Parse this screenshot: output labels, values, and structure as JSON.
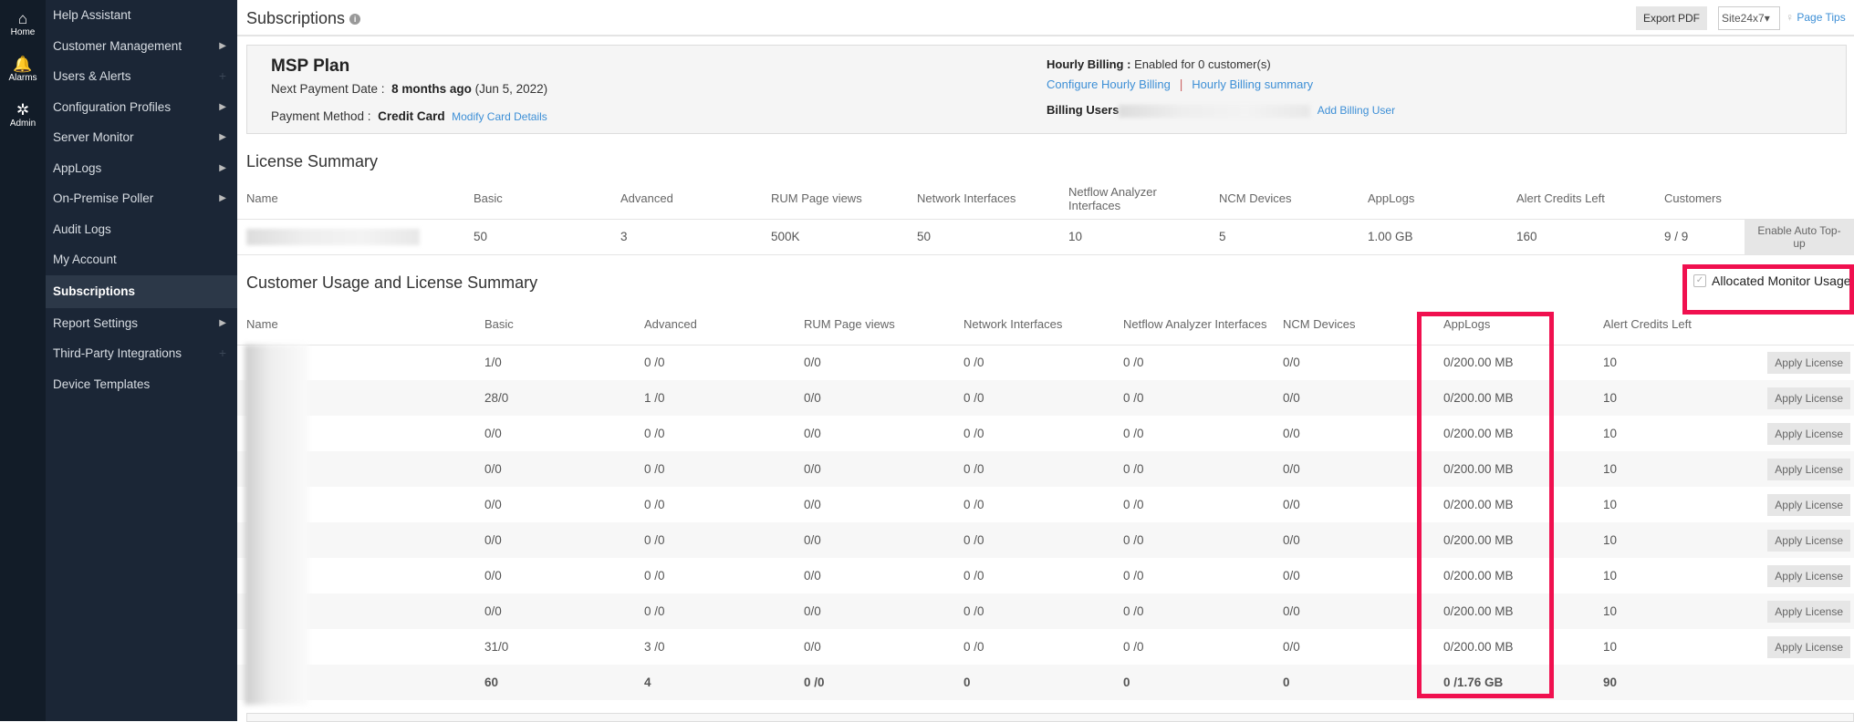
{
  "iconbar": [
    {
      "label": "Home",
      "icon": "home-icon"
    },
    {
      "label": "Alarms",
      "icon": "bell-icon"
    },
    {
      "label": "Admin",
      "icon": "gear-icon"
    }
  ],
  "sidebar": {
    "items": [
      {
        "label": "Help Assistant",
        "mark": ""
      },
      {
        "label": "Customer Management",
        "mark": "arrow"
      },
      {
        "label": "Users & Alerts",
        "mark": "plus"
      },
      {
        "label": "Configuration Profiles",
        "mark": "arrow"
      },
      {
        "label": "Server Monitor",
        "mark": "arrow"
      },
      {
        "label": "AppLogs",
        "mark": "arrow"
      },
      {
        "label": "On-Premise Poller",
        "mark": "arrow"
      },
      {
        "label": "Audit Logs",
        "mark": ""
      },
      {
        "label": "My Account",
        "mark": ""
      },
      {
        "label": "Subscriptions",
        "mark": "",
        "active": true
      },
      {
        "label": "Report Settings",
        "mark": "arrow"
      },
      {
        "label": "Third-Party Integrations",
        "mark": "plus"
      },
      {
        "label": "Device Templates",
        "mark": ""
      }
    ]
  },
  "header": {
    "title": "Subscriptions",
    "export": "Export PDF",
    "site": "Site24x7",
    "page_tips": "Page Tips"
  },
  "plan": {
    "name": "MSP Plan",
    "next_payment_label": "Next Payment Date :",
    "next_payment_rel": "8 months ago",
    "next_payment_date": "(Jun 5, 2022)",
    "payment_method_label": "Payment Method :",
    "payment_method": "Credit Card",
    "modify": "Modify Card Details",
    "hourly_label": "Hourly Billing :",
    "hourly_value": "Enabled for 0 customer(s)",
    "configure": "Configure Hourly Billing",
    "sep": "|",
    "summary": "Hourly Billing summary",
    "billing_users_label": "Billing Users",
    "add_billing_user": "Add Billing User"
  },
  "license": {
    "title": "License Summary",
    "headers": [
      "Name",
      "Basic",
      "Advanced",
      "RUM Page views",
      "Network Interfaces",
      "Netflow Analyzer Interfaces",
      "NCM Devices",
      "AppLogs",
      "Alert Credits Left",
      "Customers"
    ],
    "row": [
      "",
      "50",
      "3",
      "500K",
      "50",
      "10",
      "5",
      "1.00 GB",
      "160",
      "9 / 9"
    ],
    "button": "Enable Auto Top-up"
  },
  "usage": {
    "title": "Customer Usage and License Summary",
    "allocated_label": "Allocated Monitor Usage",
    "allocated_checked": true,
    "highlight_color": "#f0104f",
    "headers": [
      "Name",
      "Basic",
      "Advanced",
      "RUM Page views",
      "Network Interfaces",
      "Netflow Analyzer Interfaces",
      "NCM Devices",
      "AppLogs",
      "Alert Credits Left",
      ""
    ],
    "button": "Apply License",
    "rows": [
      [
        "",
        "1/0",
        "0 /0",
        "0/0",
        "0 /0",
        "0 /0",
        "0/0",
        "0/200.00 MB",
        "10"
      ],
      [
        "",
        "28/0",
        "1 /0",
        "0/0",
        "0 /0",
        "0 /0",
        "0/0",
        "0/200.00 MB",
        "10"
      ],
      [
        "",
        "0/0",
        "0 /0",
        "0/0",
        "0 /0",
        "0 /0",
        "0/0",
        "0/200.00 MB",
        "10"
      ],
      [
        "",
        "0/0",
        "0 /0",
        "0/0",
        "0 /0",
        "0 /0",
        "0/0",
        "0/200.00 MB",
        "10"
      ],
      [
        "",
        "0/0",
        "0 /0",
        "0/0",
        "0 /0",
        "0 /0",
        "0/0",
        "0/200.00 MB",
        "10"
      ],
      [
        "",
        "0/0",
        "0 /0",
        "0/0",
        "0 /0",
        "0 /0",
        "0/0",
        "0/200.00 MB",
        "10"
      ],
      [
        "",
        "0/0",
        "0 /0",
        "0/0",
        "0 /0",
        "0 /0",
        "0/0",
        "0/200.00 MB",
        "10"
      ],
      [
        "",
        "0/0",
        "0 /0",
        "0/0",
        "0 /0",
        "0 /0",
        "0/0",
        "0/200.00 MB",
        "10"
      ],
      [
        "",
        "31/0",
        "3 /0",
        "0/0",
        "0 /0",
        "0 /0",
        "0/0",
        "0/200.00 MB",
        "10"
      ]
    ],
    "total": [
      "",
      "60",
      "4",
      "0 /0",
      "0",
      "0",
      "0",
      "0 /1.76 GB",
      "90"
    ]
  }
}
